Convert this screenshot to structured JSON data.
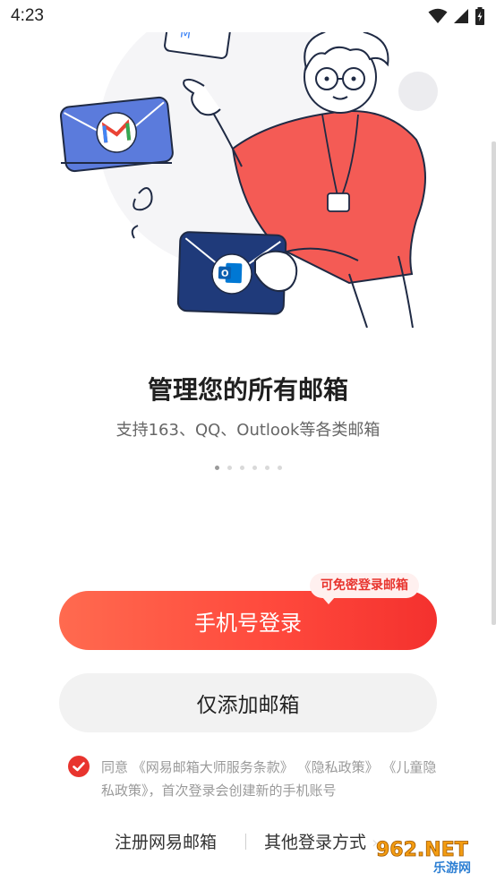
{
  "status_bar": {
    "time": "4:23",
    "wifi_icon": "wifi-icon",
    "signal_icon": "signal-icon",
    "battery_icon": "battery-charging-icon"
  },
  "hero": {
    "title": "管理您的所有邮箱",
    "subtitle": "支持163、QQ、Outlook等各类邮箱",
    "pager": {
      "count": 6,
      "active_index": 0
    }
  },
  "buttons": {
    "phone_login": "手机号登录",
    "phone_login_badge": "可免密登录邮箱",
    "add_mailbox_only": "仅添加邮箱"
  },
  "agreement": {
    "checked": true,
    "prefix": "同意",
    "terms": "《网易邮箱大师服务条款》",
    "privacy": "《隐私政策》",
    "children_privacy": "《儿童隐私政策》",
    "suffix": "，首次登录会创建新的手机账号"
  },
  "footer": {
    "register": "注册网易邮箱",
    "other_login": "其他登录方式",
    "chevron": "›"
  },
  "watermark": {
    "brand": "962.NET",
    "sub": "乐游网"
  },
  "colors": {
    "accent": "#e8342e",
    "gradient_start": "#ff6a4f",
    "gradient_end": "#f4312e",
    "navy": "#1f3a7a"
  }
}
